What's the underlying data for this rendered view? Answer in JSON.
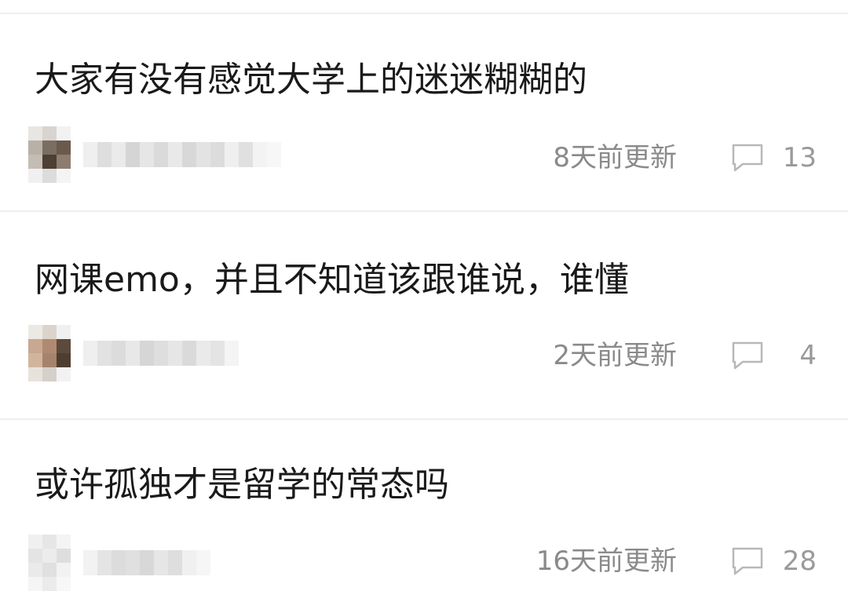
{
  "posts": [
    {
      "title": "大家有没有感觉大学上的迷迷糊糊的",
      "updated": "8天前更新",
      "comment_count": "13"
    },
    {
      "title": "网课emo，并且不知道该跟谁说，谁懂",
      "updated": "2天前更新",
      "comment_count": "4"
    },
    {
      "title": "或许孤独才是留学的常态吗",
      "updated": "16天前更新",
      "comment_count": "28"
    }
  ],
  "icons": {
    "comment": "comment-bubble-icon"
  },
  "colors": {
    "title": "#1a1a1a",
    "meta": "#8a8a8a",
    "divider": "#eeeeee"
  }
}
